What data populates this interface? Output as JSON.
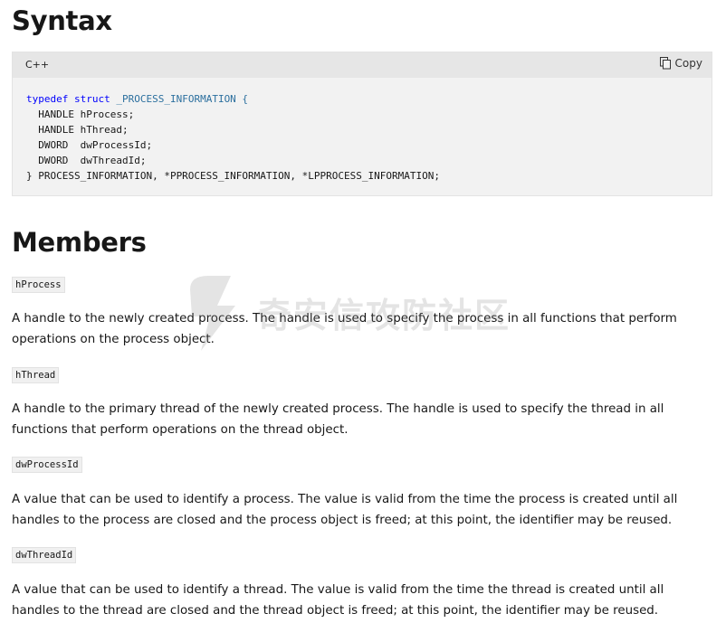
{
  "syntax": {
    "heading": "Syntax",
    "code_block": {
      "language": "C++",
      "copy_label": "Copy",
      "lines": [
        {
          "kw": "typedef",
          "kw2": "struct",
          "rest": " _PROCESS_INFORMATION {"
        },
        {
          "text": "  HANDLE hProcess;"
        },
        {
          "text": "  HANDLE hThread;"
        },
        {
          "text": "  DWORD  dwProcessId;"
        },
        {
          "text": "  DWORD  dwThreadId;"
        },
        {
          "text": "} PROCESS_INFORMATION, *PPROCESS_INFORMATION, *LPPROCESS_INFORMATION;"
        }
      ]
    }
  },
  "members": {
    "heading": "Members",
    "items": [
      {
        "name": "hProcess",
        "description": "A handle to the newly created process. The handle is used to specify the process in all functions that perform operations on the process object."
      },
      {
        "name": "hThread",
        "description": "A handle to the primary thread of the newly created process. The handle is used to specify the thread in all functions that perform operations on the thread object."
      },
      {
        "name": "dwProcessId",
        "description": "A value that can be used to identify a process. The value is valid from the time the process is created until all handles to the process are closed and the process object is freed; at this point, the identifier may be reused."
      },
      {
        "name": "dwThreadId",
        "description": "A value that can be used to identify a thread. The value is valid from the time the thread is created until all handles to the thread are closed and the thread object is freed; at this point, the identifier may be reused."
      }
    ]
  },
  "watermark": {
    "text": "奇安信攻防社区",
    "icon": "lightning-logo-icon"
  }
}
